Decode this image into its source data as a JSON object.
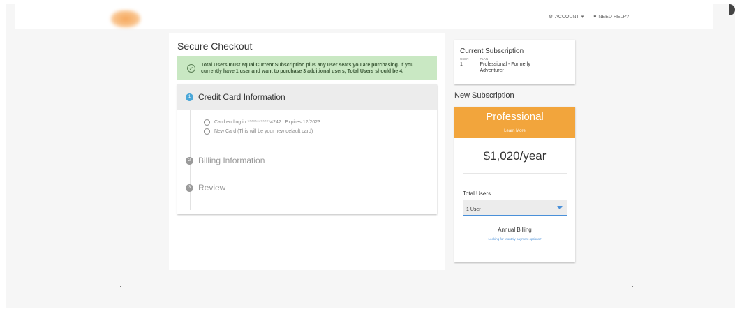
{
  "header": {
    "account_label": "ACCOUNT",
    "help_label": "NEED HELP?"
  },
  "checkout": {
    "title": "Secure Checkout",
    "notice": "Total Users must equal Current Subscription plus any user seats you are purchasing. If you currently have 1 user and want to purchase 3 additional users, Total Users should be 4.",
    "steps": [
      {
        "number": "1",
        "title": "Credit Card Information",
        "options": [
          "Card ending in ************4242 | Expires 12/2023",
          "New Card (This will be your new default card)"
        ]
      },
      {
        "number": "2",
        "title": "Billing Information"
      },
      {
        "number": "3",
        "title": "Review"
      }
    ]
  },
  "current_subscription": {
    "title": "Current Subscription",
    "user_header": "USER",
    "plan_header": "PLAN",
    "user_value": "1",
    "plan_value": "Professional - Formerly Adventurer"
  },
  "new_subscription": {
    "title": "New Subscription",
    "plan_name": "Professional",
    "learn_more": "Learn More",
    "price": "$1,020/year",
    "total_users_label": "Total Users",
    "total_users_value": "1 User",
    "billing_label": "Annual Billing",
    "payment_options_link": "Looking for Monthly payment options?"
  },
  "colors": {
    "accent_orange": "#f2a53c",
    "accent_blue": "#4aa7d8",
    "notice_green": "#c9e8c3"
  }
}
